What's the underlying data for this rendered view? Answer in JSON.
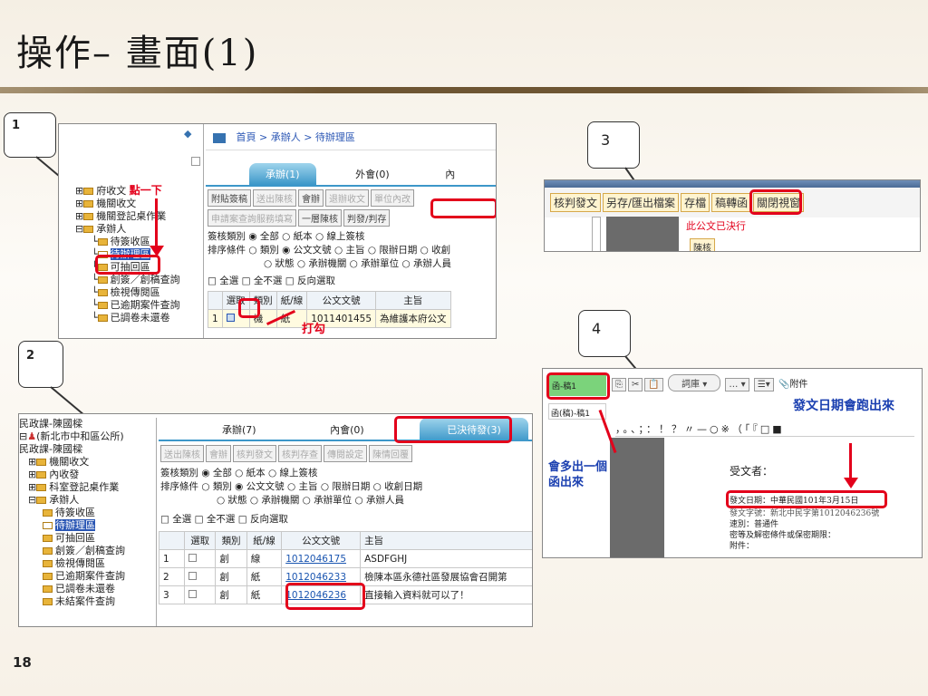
{
  "slide": {
    "title": "操作– 畫面(1)",
    "page": "18"
  },
  "callouts": [
    "1",
    "2",
    "3",
    "4"
  ],
  "p1": {
    "breadcrumb": "首頁 > 承辦人 > 待辦理區",
    "tree": [
      "府收文",
      "機關收文",
      "機關登記桌作業",
      "承辦人",
      "待簽收區",
      "待辦理區",
      "可抽回區",
      "創簽／創稿查詢",
      "檢視傳閱區",
      "已逾期案件查詢",
      "已調卷未還卷"
    ],
    "note_click": "點一下",
    "tabs": [
      "承辦(1)",
      "外會(0)",
      "內"
    ],
    "btn_row1": [
      "附貼簽稿",
      "送出陳核",
      "會辦",
      "退辦收文",
      "單位內改"
    ],
    "btn_row2": [
      "申請案查詢服務填寫",
      "一層陳核",
      "判發/判存"
    ],
    "filter1": "簽核類別 ◉ 全部 ○ 紙本 ○ 線上簽核",
    "filter2": "排序條件 ○ 類別 ◉ 公文文號 ○ 主旨 ○ 限辦日期 ○ 收創",
    "filter3": "○ 狀態 ○ 承辦機關 ○ 承辦單位 ○ 承辦人員",
    "select": "□ 全選 □ 全不選 □ 反向選取",
    "headers": [
      "選取",
      "類別",
      "紙/線",
      "公文文號",
      "主旨"
    ],
    "row": [
      "1",
      "機",
      "紙",
      "1011401455",
      "為維護本府公文"
    ],
    "note_check": "打勾"
  },
  "p2": {
    "user": "民政課-陳國樑",
    "org": "(新北市中和區公所)",
    "user2": "民政課-陳國樑",
    "tree": [
      "機關收文",
      "內收發",
      "科室登記桌作業",
      "承辦人",
      "待簽收區",
      "待辦理區",
      "可抽回區",
      "創簽／創稿查詢",
      "檢視傳閱區",
      "已逾期案件查詢",
      "已調卷未還卷",
      "未結案件查詢"
    ],
    "tabs": [
      "承辦(7)",
      "內會(0)",
      "已決待發(3)"
    ],
    "buttons": [
      "送出陳核",
      "會辦",
      "核判發文",
      "核判存查",
      "傳閱設定",
      "陳情回覆"
    ],
    "filter1": "簽核類別 ◉ 全部 ○ 紙本 ○ 線上簽核",
    "filter2": "排序條件 ○ 類別 ◉ 公文文號 ○ 主旨 ○ 限辦日期 ○ 收創日期",
    "filter3": "○ 狀態 ○ 承辦機關 ○ 承辦單位 ○ 承辦人員",
    "select": "□ 全選 □ 全不選 □ 反向選取",
    "headers": [
      "選取",
      "類別",
      "紙/線",
      "公文文號",
      "主旨"
    ],
    "rows": [
      [
        "1",
        "創",
        "線",
        "1012046175",
        "ASDFGHJ"
      ],
      [
        "2",
        "創",
        "紙",
        "1012046233",
        "檢陳本區永德社區發展協會召開第"
      ],
      [
        "3",
        "創",
        "紙",
        "1012046236",
        "直接輸入資料就可以了！"
      ]
    ]
  },
  "p3": {
    "buttons": [
      "核判發文",
      "另存/匯出檔案",
      "存檔",
      "稿轉函",
      "關閉視窗"
    ],
    "status": "此公文已決行",
    "sub_btn": "陳核"
  },
  "p4": {
    "doc_tab1": "函-稿1",
    "doc_tab2": "函(稿)-稿1",
    "toolbar": "詞庫",
    "attach": "附件",
    "punct": "，。、；：！？〃—○※（「『□■",
    "note_date": "發文日期會跑出來",
    "note_new": "會多出一個函出來",
    "recipient": "受文者：",
    "date_line": "發文日期：中華民國101年3月15日",
    "lines": [
      "發文字號：新北中民字第1012046236號",
      "速別：普通件",
      "密等及解密條件或保密期限：",
      "附件："
    ]
  },
  "colors": {
    "accent": "#e3001b",
    "title_bar": "#6e5533",
    "tab": "#3c97c9"
  }
}
